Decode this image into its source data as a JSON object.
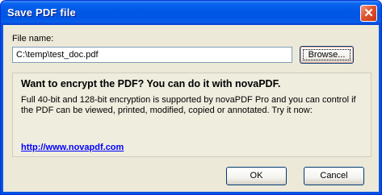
{
  "window": {
    "title": "Save PDF file",
    "close_glyph": "✕",
    "close_icon": "close-icon"
  },
  "file": {
    "label": "File name:",
    "value": "C:\\temp\\test_doc.pdf",
    "browse_label": "Browse..."
  },
  "promo": {
    "heading": "Want to encrypt the PDF? You can do it with novaPDF.",
    "body": "Full 40-bit and 128-bit encryption is supported by novaPDF Pro and you can control if the PDF can be viewed, printed, modified, copied or annotated. Try it now:",
    "link": "http://www.novapdf.com"
  },
  "buttons": {
    "ok": "OK",
    "cancel": "Cancel"
  },
  "colors": {
    "titlebar": "#0058e6",
    "client_bg": "#ece9d8",
    "link": "#0000ff",
    "close_button": "#e0532c"
  }
}
